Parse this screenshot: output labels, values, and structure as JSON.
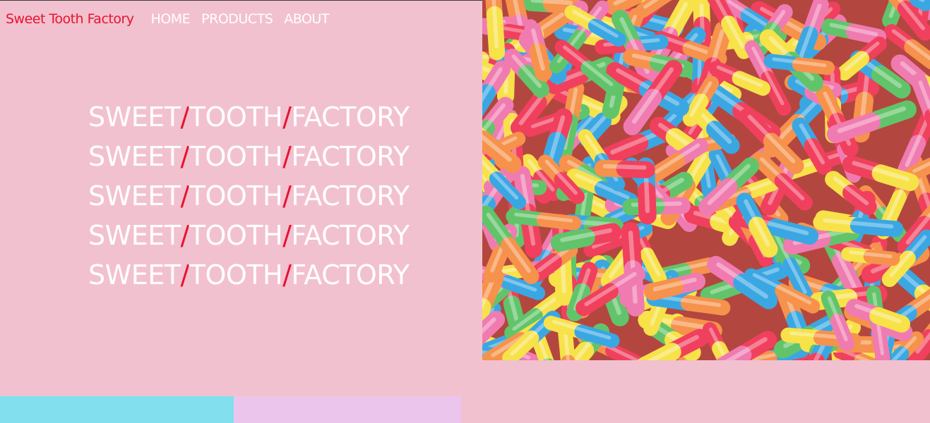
{
  "nav": {
    "brand": "Sweet Tooth Factory",
    "links": [
      "HOME",
      "PRODUCTS",
      "ABOUT"
    ]
  },
  "hero": {
    "lines": [
      [
        "SWEET",
        "/",
        "TOOTH",
        "/",
        "FACTORY"
      ],
      [
        "SWEET",
        "/",
        "TOOTH",
        "/",
        "FACTORY"
      ],
      [
        "SWEET",
        "/",
        "TOOTH",
        "/",
        "FACTORY"
      ],
      [
        "SWEET",
        "/",
        "TOOTH",
        "/",
        "FACTORY"
      ],
      [
        "SWEET",
        "/",
        "TOOTH",
        "/",
        "FACTORY"
      ]
    ]
  },
  "colors": {
    "background": "#f2c1cf",
    "brand": "#e8132e",
    "nav_text": "#ffffff",
    "tile_blue": "#82dfee",
    "tile_lilac": "#ecc5ed"
  },
  "image": {
    "subject": "sour gummy worms candy photo",
    "candy_colors": [
      "#f0405e",
      "#3aa7e3",
      "#f7e24a",
      "#62c46a",
      "#f6924b",
      "#f07bb0"
    ]
  }
}
